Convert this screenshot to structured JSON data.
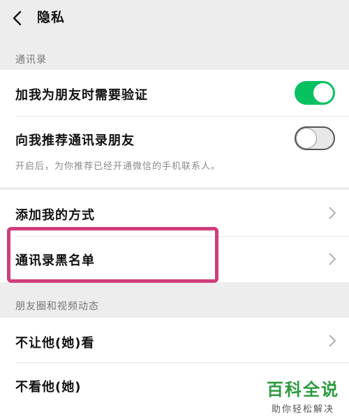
{
  "header": {
    "title": "隐私"
  },
  "sections": {
    "contacts": "通讯录",
    "moments": "朋友圈和视频动态"
  },
  "rows": {
    "verify": {
      "label": "加我为朋友时需要验证",
      "toggle": "on"
    },
    "recommend": {
      "label": "向我推荐通讯录朋友",
      "desc": "开启后，为你推荐已经开通微信的手机联系人。",
      "toggle": "off"
    },
    "add_methods": {
      "label": "添加我的方式"
    },
    "blacklist": {
      "label": "通讯录黑名单"
    },
    "hide_from": {
      "label": "不让他(她)看"
    },
    "dont_see": {
      "label": "不看他(她)"
    }
  },
  "watermark": {
    "title": "百科全说",
    "subtitle": "助你轻松解决"
  },
  "colors": {
    "accent": "#07c160",
    "highlight": "#cf3d7c",
    "watermark": "#2b9a3d"
  }
}
